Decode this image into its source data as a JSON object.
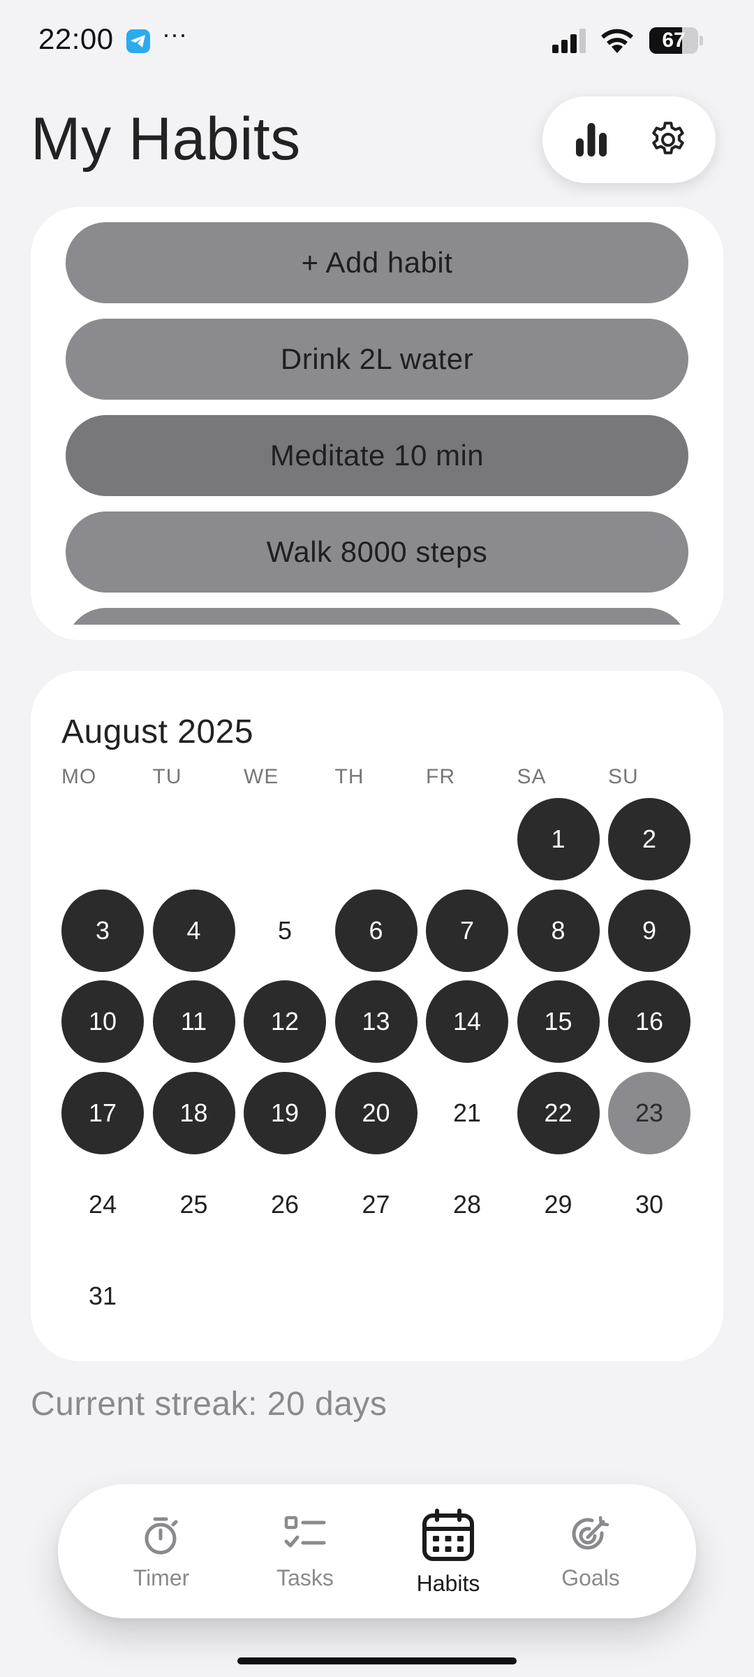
{
  "status_bar": {
    "time": "22:00",
    "more": "···",
    "battery_level": "67",
    "battery_fraction": 0.67
  },
  "header": {
    "title": "My Habits",
    "stats_icon": "bar-chart-icon",
    "settings_icon": "gear-icon"
  },
  "habits": {
    "items": [
      {
        "label": "+ Add habit",
        "state": "normal"
      },
      {
        "label": "Drink 2L water",
        "state": "normal"
      },
      {
        "label": "Meditate 10 min",
        "state": "selected"
      },
      {
        "label": "Walk 8000 steps",
        "state": "normal"
      },
      {
        "label": "",
        "state": "partial"
      }
    ]
  },
  "calendar": {
    "month_label": "August 2025",
    "weekdays": [
      "MO",
      "TU",
      "WE",
      "TH",
      "FR",
      "SA",
      "SU"
    ],
    "first_weekday_index": 5,
    "days": [
      {
        "day": "1",
        "status": "done"
      },
      {
        "day": "2",
        "status": "done"
      },
      {
        "day": "3",
        "status": "done"
      },
      {
        "day": "4",
        "status": "done"
      },
      {
        "day": "5",
        "status": "none"
      },
      {
        "day": "6",
        "status": "done"
      },
      {
        "day": "7",
        "status": "done"
      },
      {
        "day": "8",
        "status": "done"
      },
      {
        "day": "9",
        "status": "done"
      },
      {
        "day": "10",
        "status": "done"
      },
      {
        "day": "11",
        "status": "done"
      },
      {
        "day": "12",
        "status": "done"
      },
      {
        "day": "13",
        "status": "done"
      },
      {
        "day": "14",
        "status": "done"
      },
      {
        "day": "15",
        "status": "done"
      },
      {
        "day": "16",
        "status": "done"
      },
      {
        "day": "17",
        "status": "done"
      },
      {
        "day": "18",
        "status": "done"
      },
      {
        "day": "19",
        "status": "done"
      },
      {
        "day": "20",
        "status": "done"
      },
      {
        "day": "21",
        "status": "none"
      },
      {
        "day": "22",
        "status": "done"
      },
      {
        "day": "23",
        "status": "today"
      },
      {
        "day": "24",
        "status": "none"
      },
      {
        "day": "25",
        "status": "none"
      },
      {
        "day": "26",
        "status": "none"
      },
      {
        "day": "27",
        "status": "none"
      },
      {
        "day": "28",
        "status": "none"
      },
      {
        "day": "29",
        "status": "none"
      },
      {
        "day": "30",
        "status": "none"
      },
      {
        "day": "31",
        "status": "none"
      }
    ]
  },
  "streak": {
    "text": "Current streak: 20 days"
  },
  "bottom_nav": {
    "items": [
      {
        "label": "Timer",
        "icon": "stopwatch-icon",
        "active": false
      },
      {
        "label": "Tasks",
        "icon": "checklist-icon",
        "active": false
      },
      {
        "label": "Habits",
        "icon": "calendar-icon",
        "active": true
      },
      {
        "label": "Goals",
        "icon": "target-icon",
        "active": false
      }
    ]
  },
  "colors": {
    "background": "#f3f3f6",
    "card": "#ffffff",
    "habit_pill": "#8b8b8f",
    "habit_pill_selected": "#78787b",
    "day_done": "#2b2b2b",
    "day_today": "#8b8b8f",
    "muted_text": "#8a8a8e"
  }
}
